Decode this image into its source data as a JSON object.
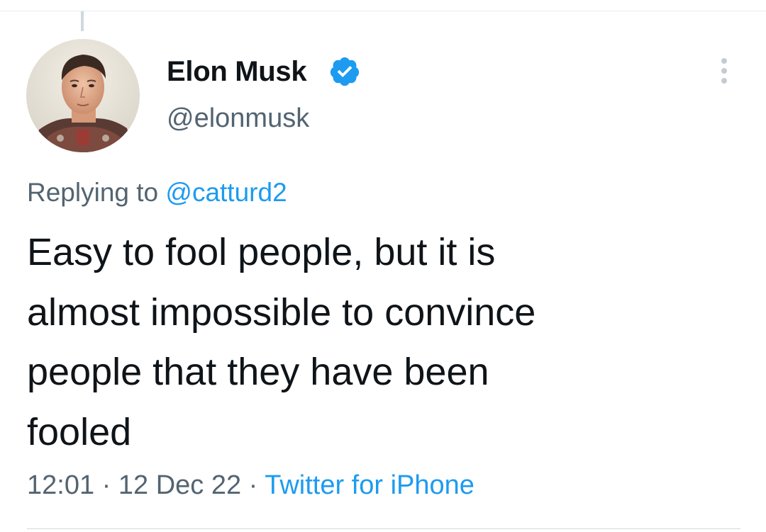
{
  "author": {
    "display_name": "Elon Musk",
    "handle": "@elonmusk",
    "verified": true,
    "avatar_icon": "profile-photo",
    "verified_icon": "verified-badge-icon",
    "verified_color": "#1d9bf0"
  },
  "reply": {
    "prefix": "Replying to ",
    "mention": "@catturd2"
  },
  "tweet": {
    "lines": [
      "Easy to fool people, but it is",
      "almost impossible to convince",
      "people that they have been",
      "fooled"
    ]
  },
  "meta": {
    "time": "12:01",
    "separator": " · ",
    "date": "12 Dec 22",
    "source": "Twitter for iPhone"
  },
  "icons": {
    "more": "more-options-icon"
  },
  "colors": {
    "text": "#0f1419",
    "secondary": "#536471",
    "accent": "#1d9bf0"
  }
}
